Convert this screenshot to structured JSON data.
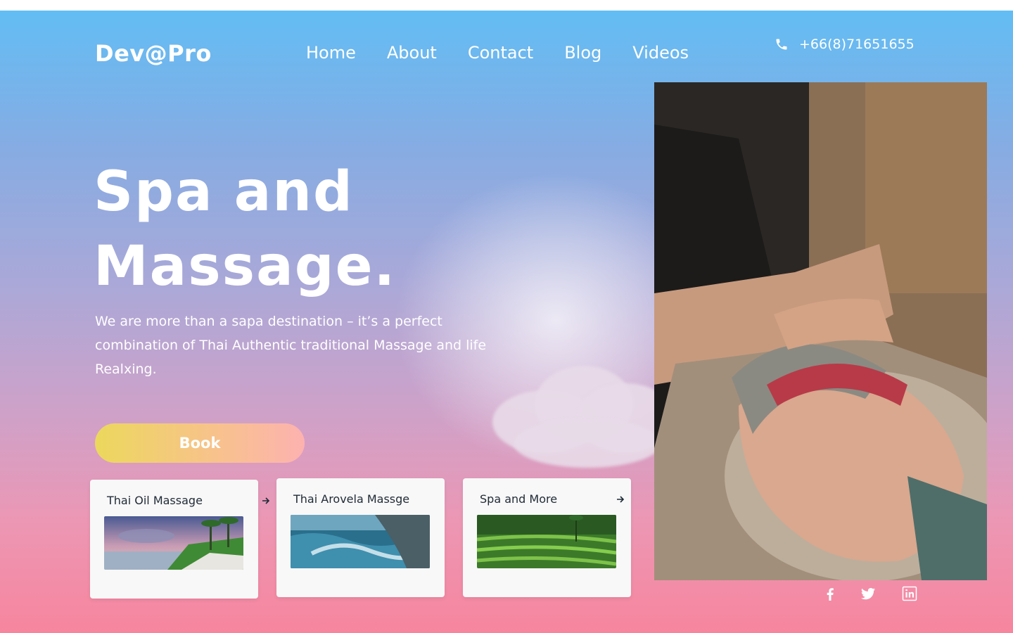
{
  "brand": {
    "logo": "Dev@Pro"
  },
  "nav": {
    "items": [
      {
        "label": "Home"
      },
      {
        "label": "About"
      },
      {
        "label": "Contact"
      },
      {
        "label": "Blog"
      },
      {
        "label": "Videos"
      }
    ]
  },
  "contact": {
    "phone": "+66(8)71651655",
    "icon": "phone-icon"
  },
  "hero": {
    "title_line1": "Spa and",
    "title_line2": "Massage.",
    "description": "We are more than a sapa destination – it’s a perfect combination of Thai Authentic traditional Massage and life Realxing.",
    "book_label": "Book"
  },
  "services": [
    {
      "title": "Thai Oil Massage",
      "image": "tropical-beach-image",
      "icon": "arrow-right-icon"
    },
    {
      "title": "Thai Arovela Massge",
      "image": "ocean-waves-image"
    },
    {
      "title": "Spa and More",
      "image": "rice-terraces-image",
      "icon": "arrow-right-icon"
    }
  ],
  "social": [
    "facebook-icon",
    "twitter-icon",
    "linkedin-icon"
  ],
  "colors": {
    "gradient_top": "#62bdf4",
    "gradient_bottom": "#f7859e",
    "button_start": "#ecd85c",
    "button_end": "#fdb2b0",
    "text": "#ffffff"
  }
}
